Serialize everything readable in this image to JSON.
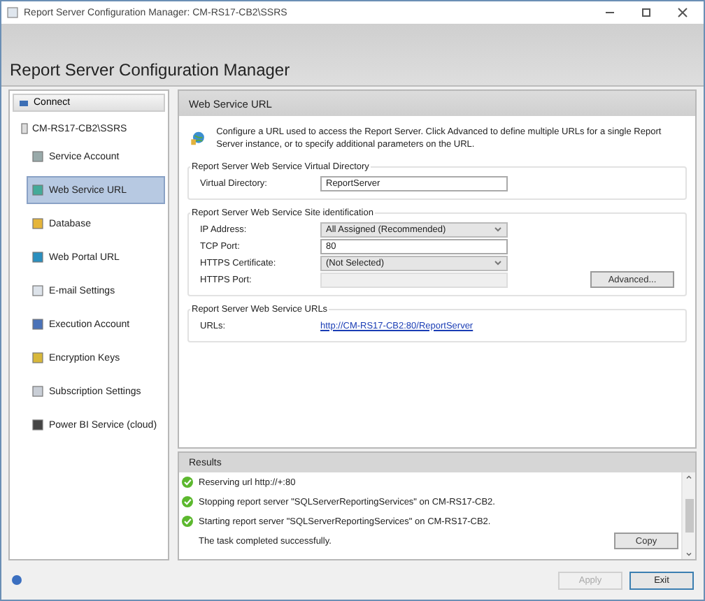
{
  "window": {
    "title": "Report Server Configuration Manager: CM-RS17-CB2\\SSRS"
  },
  "header": {
    "title": "Report Server Configuration Manager"
  },
  "sidebar": {
    "connect": "Connect",
    "server": "CM-RS17-CB2\\SSRS",
    "items": [
      {
        "label": "Service Account",
        "selected": false
      },
      {
        "label": "Web Service URL",
        "selected": true
      },
      {
        "label": "Database",
        "selected": false
      },
      {
        "label": "Web Portal URL",
        "selected": false
      },
      {
        "label": "E-mail Settings",
        "selected": false
      },
      {
        "label": "Execution Account",
        "selected": false
      },
      {
        "label": "Encryption Keys",
        "selected": false
      },
      {
        "label": "Subscription Settings",
        "selected": false
      },
      {
        "label": "Power BI Service (cloud)",
        "selected": false
      }
    ]
  },
  "panel": {
    "title": "Web Service URL",
    "description": "Configure a URL used to access the Report Server.  Click Advanced to define multiple URLs for a single Report Server instance, or to specify additional parameters on the URL.",
    "groups": [
      {
        "legend": "Report Server Web Service Virtual Directory",
        "fields": [
          {
            "kind": "text",
            "label": "Virtual Directory:",
            "value": "ReportServer",
            "disabled": false
          }
        ]
      },
      {
        "legend": "Report Server Web Service Site identification",
        "fields": [
          {
            "kind": "select",
            "label": "IP Address:",
            "value": "All Assigned (Recommended)",
            "disabled": false
          },
          {
            "kind": "text",
            "label": "TCP Port:",
            "value": "80",
            "disabled": false
          },
          {
            "kind": "select",
            "label": "HTTPS Certificate:",
            "value": "(Not Selected)",
            "disabled": false
          },
          {
            "kind": "text",
            "label": "HTTPS Port:",
            "disabled": true
          }
        ],
        "button": {
          "label": "Advanced...",
          "disabled": false
        }
      },
      {
        "legend": "Report Server Web Service URLs",
        "fields": [
          {
            "kind": "link",
            "label": "URLs:",
            "value": "http://CM-RS17-CB2:80/ReportServer",
            "disabled": false
          }
        ]
      }
    ]
  },
  "results": {
    "title": "Results",
    "items": [
      {
        "kind": "success",
        "text": "Reserving url http://+:80"
      },
      {
        "kind": "success",
        "text": "Stopping report server \"SQLServerReportingServices\" on CM-RS17-CB2."
      },
      {
        "kind": "success",
        "text": "Starting report server \"SQLServerReportingServices\" on CM-RS17-CB2."
      },
      {
        "kind": "plain",
        "text": "The task completed successfully."
      }
    ],
    "copy": "Copy"
  },
  "footer": {
    "buttons": [
      {
        "label": "Apply",
        "disabled": true
      },
      {
        "label": "Exit",
        "disabled": false
      }
    ]
  }
}
